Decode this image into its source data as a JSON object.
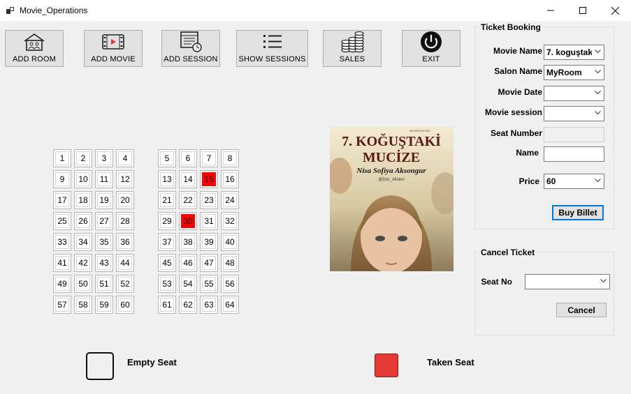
{
  "window": {
    "title": "Movie_Operations"
  },
  "toolbar": [
    {
      "label": "ADD ROOM",
      "icon": "home-icon"
    },
    {
      "label": "ADD MOVIE",
      "icon": "film-icon"
    },
    {
      "label": "ADD SESSION",
      "icon": "schedule-icon"
    },
    {
      "label": "SHOW SESSIONS",
      "icon": "list-icon"
    },
    {
      "label": "SALES",
      "icon": "coins-icon"
    },
    {
      "label": "EXIT",
      "icon": "power-icon"
    }
  ],
  "seats": {
    "left": [
      "1",
      "2",
      "3",
      "4",
      "9",
      "10",
      "11",
      "12",
      "17",
      "18",
      "19",
      "20",
      "25",
      "26",
      "27",
      "28",
      "33",
      "34",
      "35",
      "36",
      "41",
      "42",
      "43",
      "44",
      "49",
      "50",
      "51",
      "52",
      "57",
      "58",
      "59",
      "60"
    ],
    "right": [
      "5",
      "6",
      "7",
      "8",
      "13",
      "14",
      "15",
      "16",
      "21",
      "22",
      "23",
      "24",
      "29",
      "30",
      "31",
      "32",
      "37",
      "38",
      "39",
      "40",
      "45",
      "46",
      "47",
      "48",
      "53",
      "54",
      "55",
      "56",
      "61",
      "62",
      "63",
      "64"
    ],
    "taken": [
      "15",
      "30"
    ],
    "taken_color": "#ff0000"
  },
  "poster": {
    "title_line1": "7. KOĞUŞTAKİ",
    "title_line2": "MUCİZE",
    "subtitle": "Nisa Sofiya Aksongur",
    "handle": "@Dizi_Afisleri",
    "brand": "MOVIEPOSTER"
  },
  "booking": {
    "title": "Ticket Booking",
    "movie_name_label": "Movie Name",
    "movie_name_value": "7. koguştak",
    "salon_name_label": "Salon Name",
    "salon_name_value": "MyRoom",
    "movie_date_label": "Movie Date",
    "movie_date_value": "",
    "movie_session_label": "Movie session",
    "movie_session_value": "",
    "seat_number_label": "Seat Number",
    "seat_number_value": "",
    "name_label": "Name",
    "name_value": "",
    "price_label": "Price",
    "price_value": "60",
    "buy_label": "Buy Billet"
  },
  "cancel": {
    "title": "Cancel Ticket",
    "seat_no_label": "Seat No",
    "seat_no_value": "",
    "cancel_label": "Cancel"
  },
  "legend": {
    "empty_label": "Empty Seat",
    "taken_label": "Taken Seat"
  }
}
